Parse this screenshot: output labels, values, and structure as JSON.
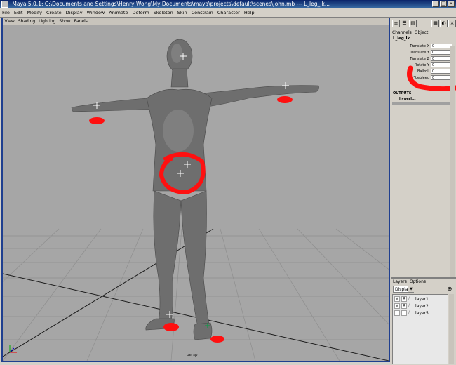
{
  "window": {
    "title": "Maya 5.0.1: C:\\Documents and Settings\\Henry Wong\\My Documents\\maya\\projects\\default\\scenes\\John.mb  ---  L_leg_Ik..."
  },
  "menubar": {
    "items": [
      "File",
      "Edit",
      "Modify",
      "Create",
      "Display",
      "Window",
      "Animate",
      "Deform",
      "Skeleton",
      "Skin",
      "Constrain",
      "Character",
      "Help"
    ]
  },
  "panel_menu": {
    "items": [
      "View",
      "Shading",
      "Lighting",
      "Show",
      "Panels"
    ]
  },
  "viewport": {
    "camera": "persp"
  },
  "channel_box": {
    "tabs": [
      "Channels",
      "Object"
    ],
    "node_name": "L_leg_Ik",
    "attributes": [
      {
        "label": "Translate X",
        "value": "0"
      },
      {
        "label": "Translate Y",
        "value": "0"
      },
      {
        "label": "Translate Z",
        "value": "0"
      },
      {
        "label": "Rotate Y",
        "value": "0"
      },
      {
        "label": "Ballroll",
        "value": "0"
      },
      {
        "label": "Toebleed",
        "value": "0"
      }
    ],
    "outputs_label": "OUTPUTS",
    "outputs_node": "hyperl..."
  },
  "layers": {
    "tabs": [
      "Layers",
      "Options"
    ],
    "display_mode": "Display",
    "items": [
      {
        "v": "V",
        "r": "R",
        "name": "layer1"
      },
      {
        "v": "V",
        "r": "R",
        "name": "layer2"
      },
      {
        "v": "",
        "r": "",
        "name": "layer5"
      }
    ]
  },
  "colors": {
    "viewport_bg": "#a6a6a6",
    "title_bar": "#0a246a",
    "annotation_mark": "#ff1010",
    "frame": "#1f3f8f"
  },
  "icons": [
    "maya-app-icon",
    "minimize-icon",
    "maximize-icon",
    "close-icon",
    "channel-box-icon",
    "attribute-editor-icon",
    "tool-settings-icon",
    "new-layer-icon",
    "axis-indicator-icon"
  ]
}
